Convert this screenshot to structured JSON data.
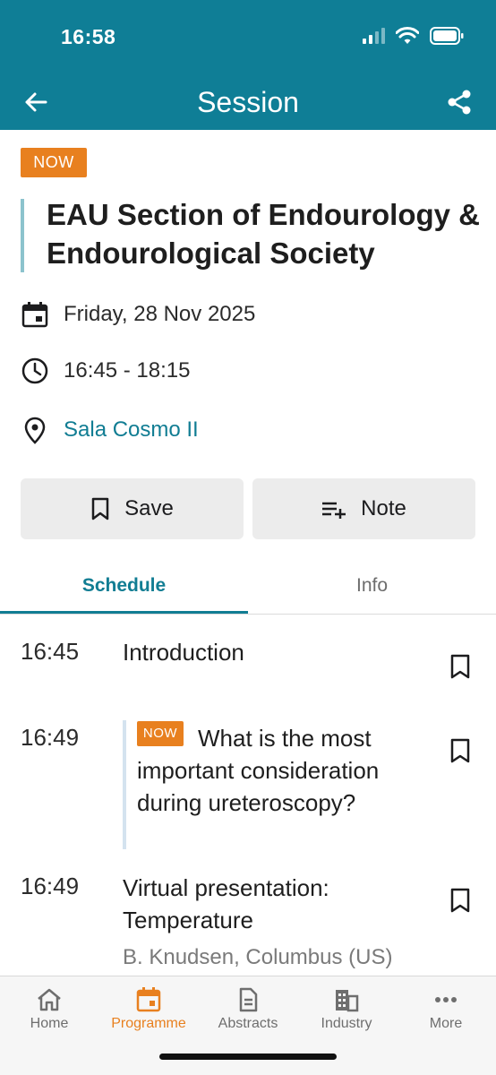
{
  "status_bar": {
    "time": "16:58"
  },
  "header": {
    "title": "Session"
  },
  "session": {
    "badge": "NOW",
    "title": "EAU Section of Endourology & Endourological Society",
    "date": "Friday, 28 Nov 2025",
    "time": "16:45 - 18:15",
    "location": "Sala Cosmo II"
  },
  "actions": {
    "save_label": "Save",
    "note_label": "Note"
  },
  "tabs": [
    {
      "label": "Schedule",
      "active": true
    },
    {
      "label": "Info",
      "active": false
    }
  ],
  "schedule": [
    {
      "time": "16:45",
      "title": "Introduction"
    },
    {
      "time": "16:49",
      "badge": "NOW",
      "title": "What is the most important consideration during ureteroscopy?"
    },
    {
      "time": "16:49",
      "title": "Virtual presentation: Temperature",
      "speaker": "B. Knudsen, Columbus (US)"
    }
  ],
  "bottom_nav": [
    {
      "label": "Home",
      "icon": "home-icon"
    },
    {
      "label": "Programme",
      "icon": "calendar-icon",
      "active": true
    },
    {
      "label": "Abstracts",
      "icon": "document-icon"
    },
    {
      "label": "Industry",
      "icon": "building-icon"
    },
    {
      "label": "More",
      "icon": "more-icon"
    }
  ],
  "colors": {
    "primary": "#0f7e96",
    "accent": "#e8801f",
    "link": "#117d93"
  }
}
